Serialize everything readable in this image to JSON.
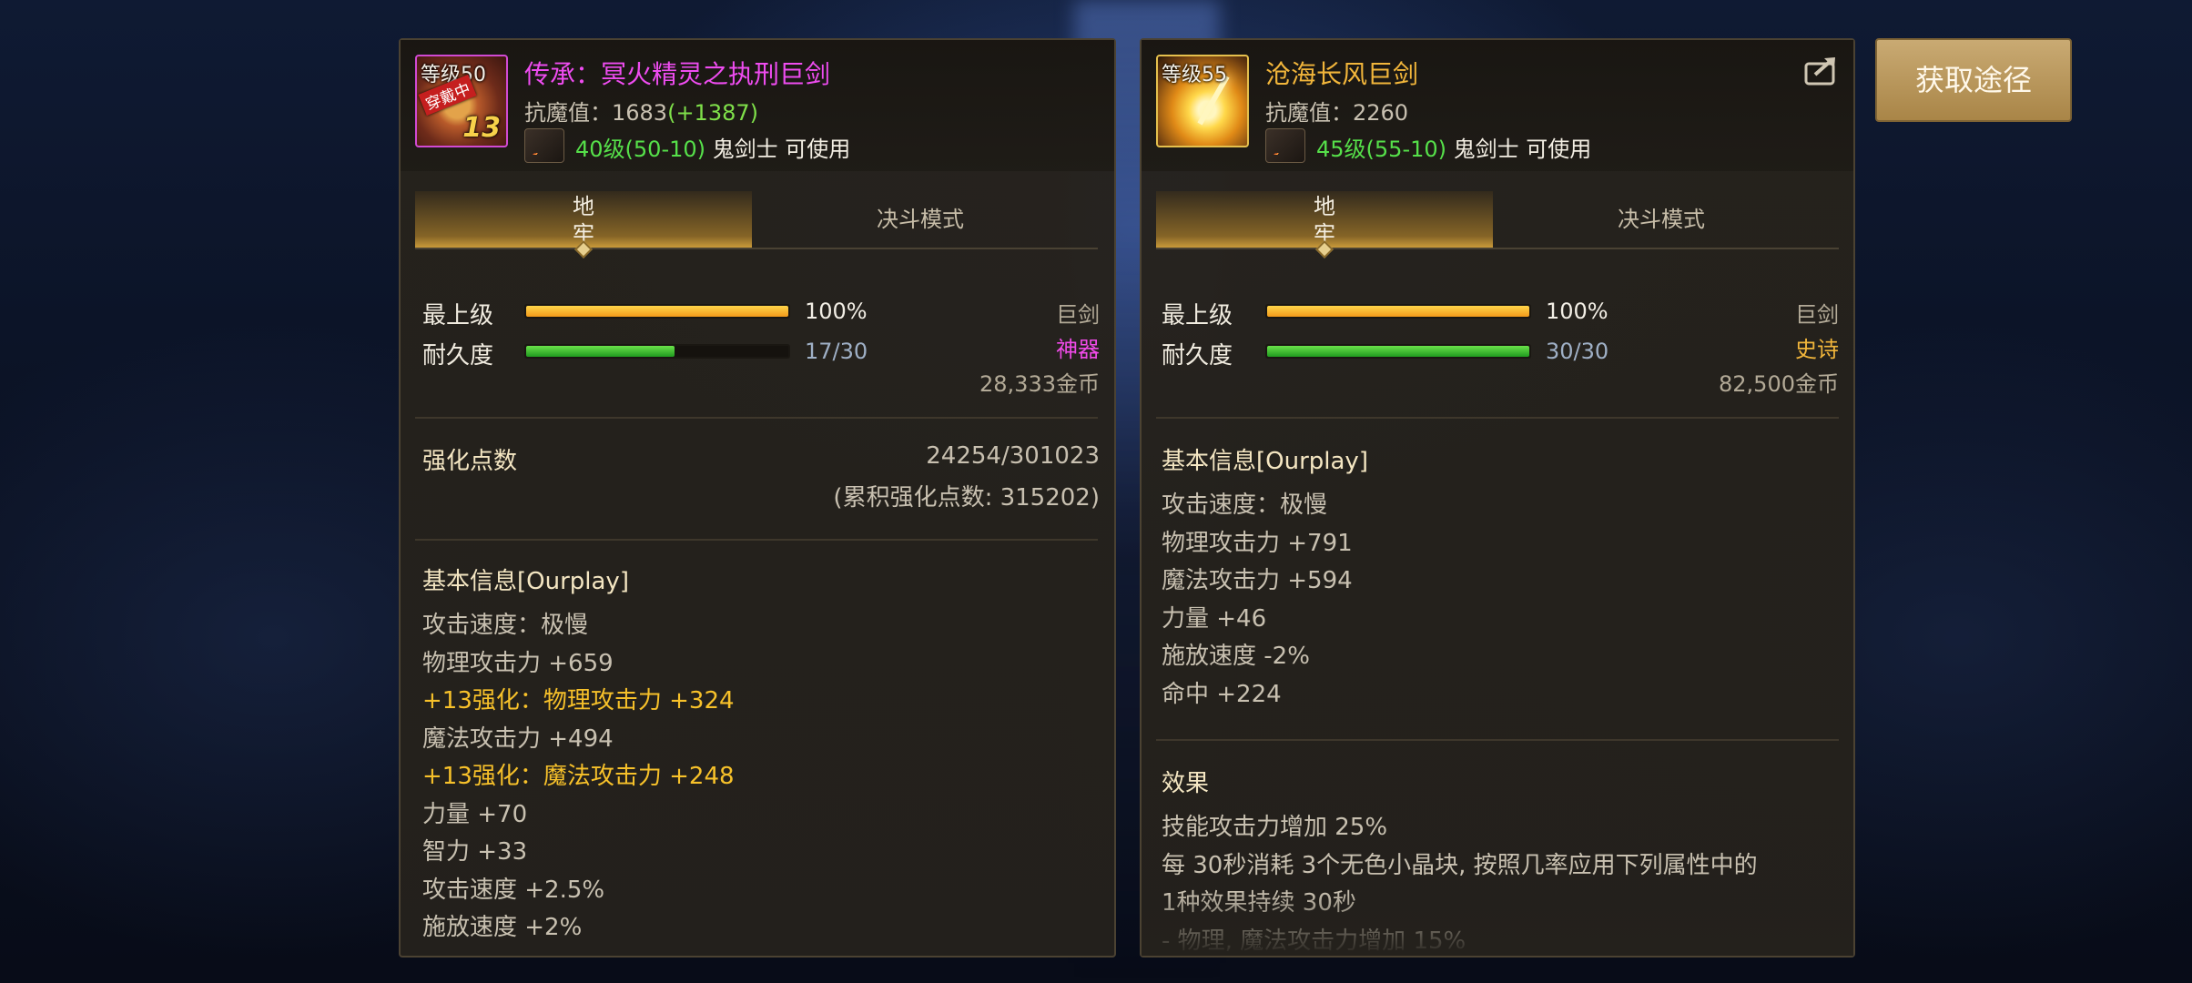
{
  "left_item": {
    "level_tag": "等级50",
    "ribbon": "穿戴中",
    "enhance_badge": "13",
    "title": "传承：冥火精灵之执刑巨剑",
    "resist_label": "抗魔值：1683",
    "resist_bonus": "(+1387)",
    "req_level": "40级(50-10)",
    "req_class": "鬼剑士 可使用",
    "tabs": [
      "地牢",
      "决斗模式"
    ],
    "max_label": "最上级",
    "max_value": "100%",
    "max_fill": 1.0,
    "durability_label": "耐久度",
    "durability_value": "17/30",
    "durability_fill": 0.567,
    "type": "巨剑",
    "rarity": "神器",
    "price": "28,333金币",
    "enh_points_label": "强化点数",
    "enh_points_value": "24254/301023",
    "enh_points_total": "(累积强化点数: 315202)",
    "basic_title": "基本信息[Ourplay]",
    "stats": [
      {
        "text": "攻击速度：极慢",
        "style": "normal"
      },
      {
        "text": "物理攻击力 +659",
        "style": "normal"
      },
      {
        "text": "+13强化：物理攻击力 +324",
        "style": "yellow"
      },
      {
        "text": "魔法攻击力 +494",
        "style": "normal"
      },
      {
        "text": "+13强化：魔法攻击力 +248",
        "style": "yellow"
      },
      {
        "text": "力量 +70",
        "style": "normal"
      },
      {
        "text": "智力 +33",
        "style": "normal"
      },
      {
        "text": "攻击速度 +2.5%",
        "style": "normal"
      },
      {
        "text": "施放速度 +2%",
        "style": "normal"
      }
    ]
  },
  "right_item": {
    "level_tag": "等级55",
    "title": "沧海长风巨剑",
    "resist_label": "抗魔值：2260",
    "req_level": "45级(55-10)",
    "req_class": "鬼剑士 可使用",
    "tabs": [
      "地牢",
      "决斗模式"
    ],
    "max_label": "最上级",
    "max_value": "100%",
    "max_fill": 1.0,
    "durability_label": "耐久度",
    "durability_value": "30/30",
    "durability_fill": 1.0,
    "type": "巨剑",
    "rarity": "史诗",
    "price": "82,500金币",
    "basic_title": "基本信息[Ourplay]",
    "stats": [
      "攻击速度：极慢",
      "物理攻击力 +791",
      "魔法攻击力 +594",
      "力量 +46",
      "施放速度 -2%",
      "命中 +224"
    ],
    "effect_title": "效果",
    "effects": [
      "技能攻击力增加 25%",
      "每 30秒消耗 3个无色小晶块, 按照几率应用下列属性中的",
      "1种效果持续 30秒",
      "- 物理, 魔法攻击力增加 15%"
    ]
  },
  "acquire_button": "获取途径",
  "icons": [
    "weapon-icon-left",
    "weapon-icon-right",
    "slayer-class-icon",
    "share-icon"
  ],
  "colors": {
    "legendary": "#ee4cf0",
    "epic": "#f2b63b",
    "bonus_green": "#7fe04a",
    "enhance_yellow": "#f7c12a",
    "level_green": "#56e04a"
  }
}
